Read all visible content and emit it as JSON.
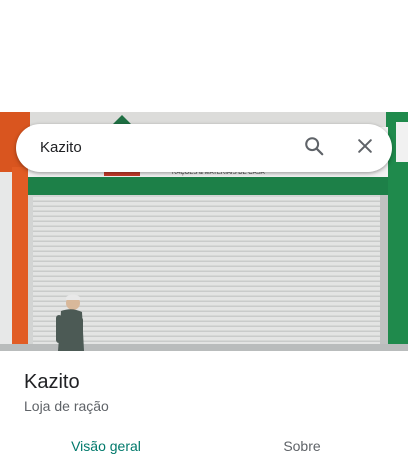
{
  "search": {
    "query": "Kazito",
    "search_icon": "search-icon",
    "close_icon": "close-icon"
  },
  "photo": {
    "subject": "storefront-with-closed-shutter",
    "sign_text": "RAÇÕES & MATERIAIS DE CASA"
  },
  "place": {
    "name": "Kazito",
    "category": "Loja de ração"
  },
  "tabs": [
    {
      "label": "Visão geral",
      "active": true
    },
    {
      "label": "Sobre",
      "active": false
    }
  ],
  "colors": {
    "accent": "#00796b",
    "secondary_text": "#5f6368",
    "primary_text": "#202124"
  }
}
